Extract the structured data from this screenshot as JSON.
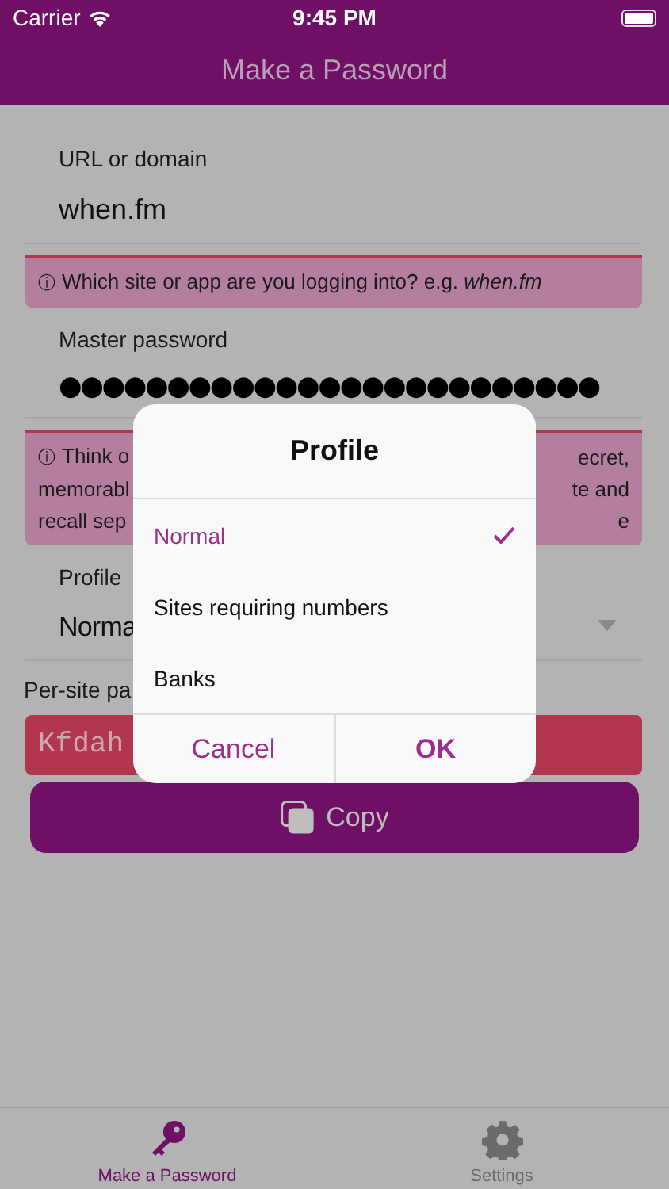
{
  "status_bar": {
    "carrier": "Carrier",
    "time": "9:45 PM"
  },
  "nav": {
    "title": "Make a Password"
  },
  "url_field": {
    "label": "URL or domain",
    "value": "when.fm"
  },
  "url_hint": {
    "icon": "ⓘ",
    "text": "Which site or app are you logging into? e.g. *when.fm*"
  },
  "master_field": {
    "label": "Master password",
    "value": "●●●●●●●●●●●●●●●●●●●●●●●●●"
  },
  "master_hint": {
    "icon": "ⓘ",
    "lines": [
      {
        "left": "Think o",
        "right": "ecret,"
      },
      {
        "left": "memorabl",
        "right": "te and"
      },
      {
        "left": "recall sep",
        "right": "e"
      }
    ]
  },
  "profile_field": {
    "label": "Profile",
    "value": "Norma"
  },
  "result": {
    "label": "Per-site pa",
    "value": "Kfdah"
  },
  "copy_button": {
    "label": "Copy"
  },
  "dialog": {
    "title": "Profile",
    "options": [
      {
        "label": "Normal",
        "selected": true
      },
      {
        "label": "Sites requiring numbers",
        "selected": false
      },
      {
        "label": "Banks",
        "selected": false
      }
    ],
    "buttons": [
      {
        "label": "Cancel",
        "kind": "cancel"
      },
      {
        "label": "OK",
        "kind": "confirm"
      }
    ]
  },
  "tabs": [
    {
      "label": "Make a Password",
      "kind": "key",
      "selected": true
    },
    {
      "label": "Settings",
      "kind": "gear",
      "selected": false
    }
  ]
}
